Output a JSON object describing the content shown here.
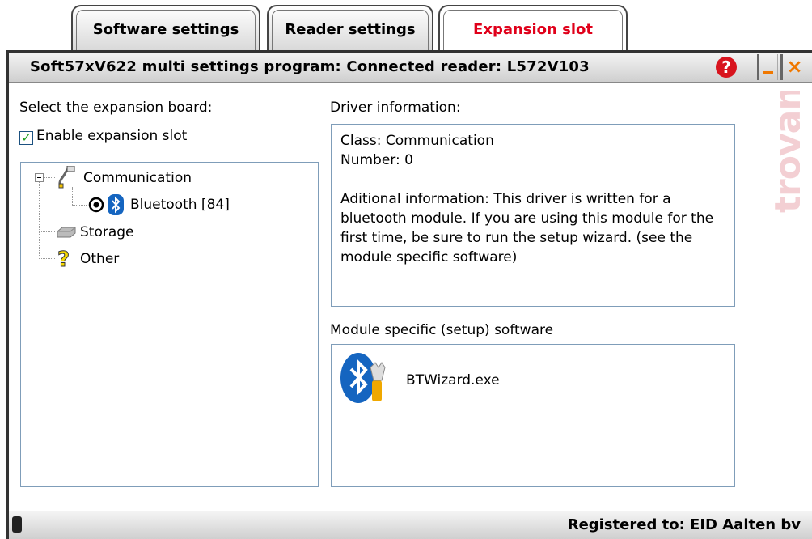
{
  "tabs": [
    {
      "label": "Software settings",
      "active": false
    },
    {
      "label": "Reader settings",
      "active": false
    },
    {
      "label": "Expansion slot",
      "active": true
    }
  ],
  "window": {
    "title": "Soft57xV622 multi settings program: Connected reader: L572V103",
    "help_label": "?",
    "close_label": "×"
  },
  "left": {
    "select_label": "Select the expansion board:",
    "enable_label": "Enable expansion slot",
    "enable_checked": true,
    "tree": {
      "communication": "Communication",
      "bluetooth": "Bluetooth [84]",
      "storage": "Storage",
      "other": "Other"
    }
  },
  "right": {
    "driver_label": "Driver information:",
    "driver_class": "Class: Communication",
    "driver_number": "Number: 0",
    "driver_info": "Aditional information: This driver is written for a bluetooth module. If you are using this module for the first time, be sure to run the setup wizard. (see the module specific software)",
    "module_label": "Module specific (setup) software",
    "module_item": "BTWizard.exe"
  },
  "watermark": "trovan",
  "status": {
    "registered": "Registered to: EID Aalten bv"
  },
  "colors": {
    "active_tab": "#e0001a",
    "accent_orange": "#f07800",
    "help_red": "#d8141e",
    "bluetooth_blue": "#1565c0"
  }
}
